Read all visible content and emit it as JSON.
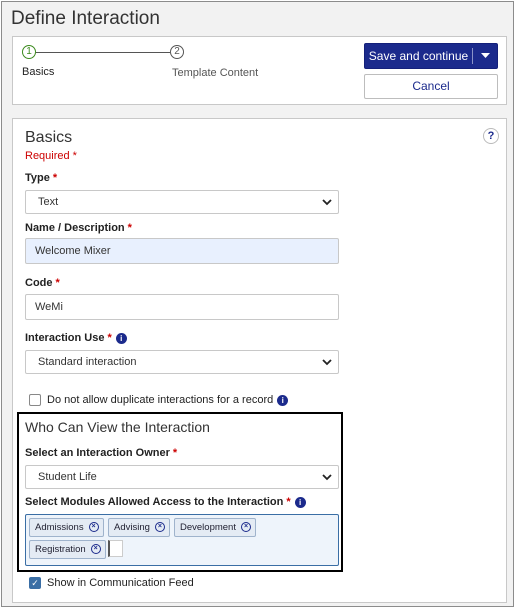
{
  "page_title": "Define Interaction",
  "wizard": {
    "steps": [
      {
        "number": "1",
        "label": "Basics"
      },
      {
        "number": "2",
        "label": "Template Content"
      }
    ]
  },
  "actions": {
    "save_label": "Save and continue",
    "cancel_label": "Cancel"
  },
  "help_icon_text": "?",
  "basics": {
    "title": "Basics",
    "required_text": "Required",
    "required_marker": "*",
    "type": {
      "label": "Type",
      "value": "Text"
    },
    "name": {
      "label": "Name / Description",
      "value": "Welcome Mixer"
    },
    "code": {
      "label": "Code",
      "value": "WeMi"
    },
    "interaction_use": {
      "label": "Interaction Use",
      "value": "Standard interaction"
    },
    "no_duplicates": {
      "label": "Do not allow duplicate interactions for a record",
      "checked": false
    }
  },
  "visibility": {
    "title": "Who Can View the Interaction",
    "owner": {
      "label": "Select an Interaction Owner",
      "value": "Student Life"
    },
    "modules": {
      "label": "Select Modules Allowed Access to the Interaction",
      "tags": [
        "Admissions",
        "Advising",
        "Development",
        "Registration"
      ]
    },
    "show_in_feed": {
      "label": "Show in Communication Feed",
      "checked": true
    }
  },
  "icons": {
    "info": "info-circle-icon",
    "chevron": "chevron-down-icon",
    "remove": "remove-circle-icon"
  },
  "colors": {
    "primary": "#1b2a8c",
    "required": "#cc0000",
    "step_complete": "#3c8a1e"
  }
}
